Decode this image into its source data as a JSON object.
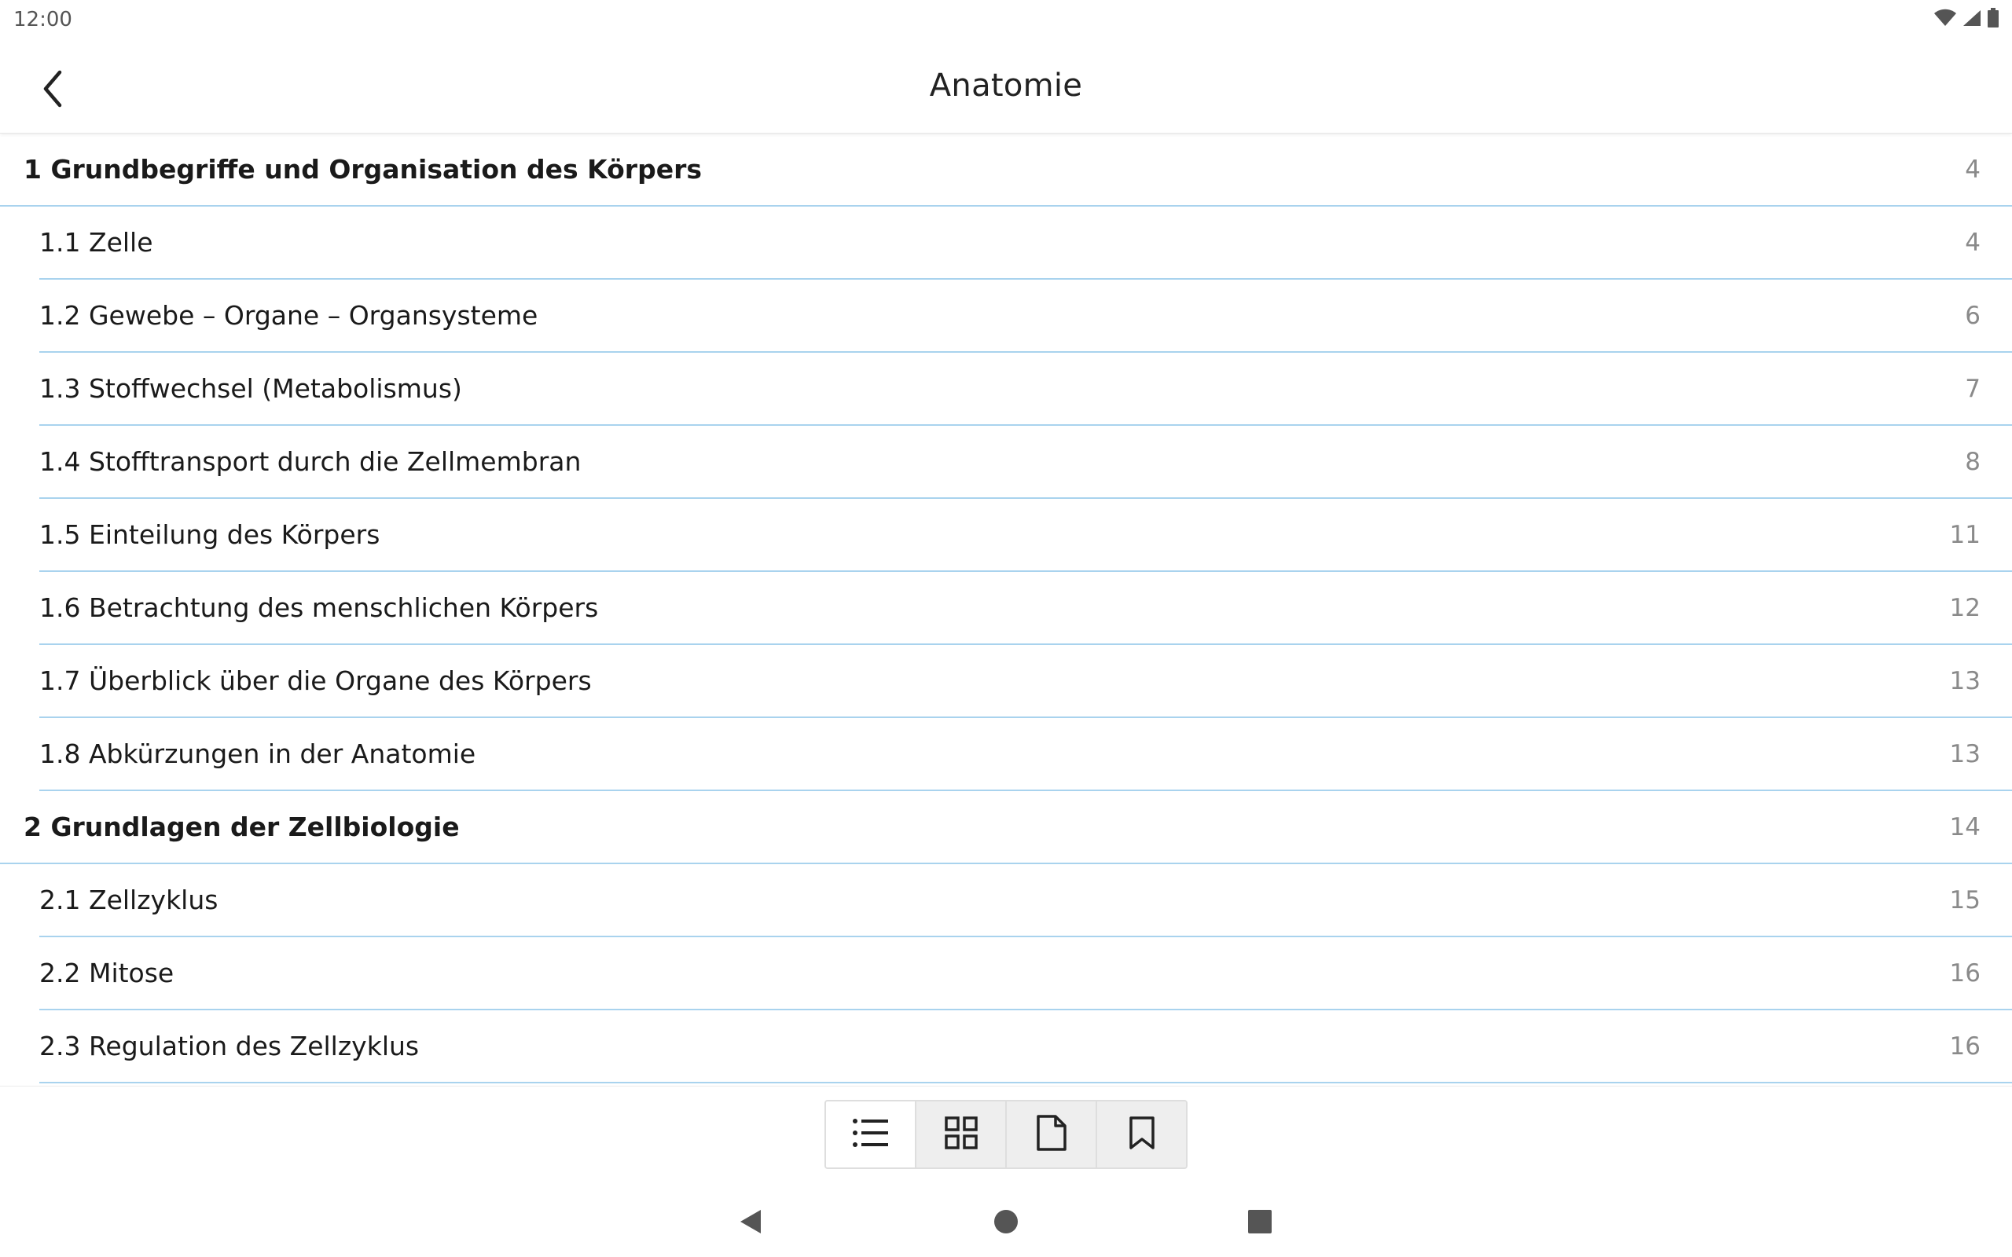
{
  "status_bar": {
    "time": "12:00",
    "icons": [
      "wifi-icon",
      "signal-icon",
      "battery-icon"
    ]
  },
  "app_bar": {
    "title": "Anatomie",
    "back_icon": "chevron-left-icon"
  },
  "toc": {
    "rows": [
      {
        "level": "chapter",
        "title": "1 Grundbegriffe und Organisation des Körpers",
        "page": "4"
      },
      {
        "level": "section",
        "title": "1.1 Zelle",
        "page": "4"
      },
      {
        "level": "section",
        "title": "1.2 Gewebe – Organe – Organsysteme",
        "page": "6"
      },
      {
        "level": "section",
        "title": "1.3 Stoffwechsel (Metabolismus)",
        "page": "7"
      },
      {
        "level": "section",
        "title": "1.4 Stofftransport durch die Zellmembran",
        "page": "8"
      },
      {
        "level": "section",
        "title": "1.5 Einteilung des Körpers",
        "page": "11"
      },
      {
        "level": "section",
        "title": "1.6 Betrachtung des menschlichen Körpers",
        "page": "12"
      },
      {
        "level": "section",
        "title": "1.7 Überblick über die Organe des Körpers",
        "page": "13"
      },
      {
        "level": "section",
        "title": "1.8 Abkürzungen in der Anatomie",
        "page": "13"
      },
      {
        "level": "chapter",
        "title": "2 Grundlagen der Zellbiologie",
        "page": "14"
      },
      {
        "level": "section",
        "title": "2.1 Zellzyklus",
        "page": "15"
      },
      {
        "level": "section",
        "title": "2.2 Mitose",
        "page": "16"
      },
      {
        "level": "section",
        "title": "2.3 Regulation des Zellzyklus",
        "page": "16"
      }
    ]
  },
  "view_toolbar": {
    "buttons": [
      {
        "icon": "list-icon",
        "active": true
      },
      {
        "icon": "grid-icon",
        "active": false
      },
      {
        "icon": "page-icon",
        "active": false
      },
      {
        "icon": "bookmark-icon",
        "active": false
      }
    ]
  },
  "nav_bar": {
    "buttons": [
      "nav-back-icon",
      "nav-home-icon",
      "nav-recents-icon"
    ]
  },
  "colors": {
    "divider": "#a9d3ee",
    "page_number": "#8a8a8a",
    "text": "#1a1a1a"
  }
}
